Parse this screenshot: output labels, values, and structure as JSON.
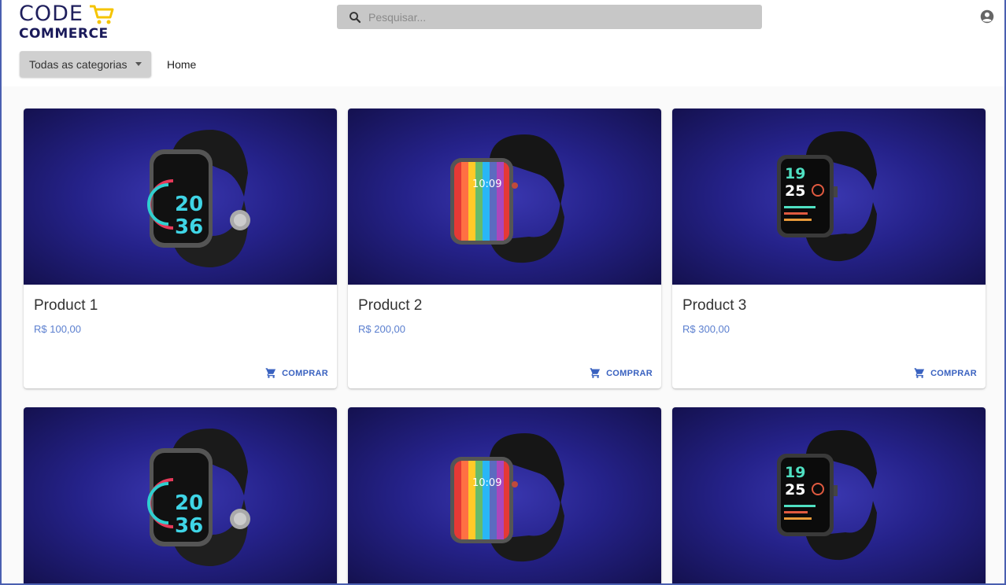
{
  "header": {
    "logo_line1": "CODE",
    "logo_line2": "COMMERCE",
    "search_placeholder": "Pesquisar...",
    "category_select": "Todas as categorias",
    "nav_home": "Home"
  },
  "colors": {
    "brand_dark": "#1a1a5a",
    "brand_yellow": "#f5c400",
    "accent_blue": "#3a62c0",
    "price_blue": "#5b7fcf",
    "image_background": "#25228a"
  },
  "products": [
    {
      "title": "Product 1",
      "price": "R$ 100,00",
      "action": "COMPRAR",
      "watch_style": "round-dial",
      "watch_texts": [
        "20",
        "36"
      ]
    },
    {
      "title": "Product 2",
      "price": "R$ 200,00",
      "action": "COMPRAR",
      "watch_style": "rainbow",
      "watch_texts": [
        "10:09"
      ]
    },
    {
      "title": "Product 3",
      "price": "R$ 300,00",
      "action": "COMPRAR",
      "watch_style": "black-fitness",
      "watch_texts": [
        "19",
        "25"
      ]
    },
    {
      "title": "",
      "price": "",
      "action": "",
      "watch_style": "round-dial",
      "watch_texts": [
        "20",
        "36"
      ]
    },
    {
      "title": "",
      "price": "",
      "action": "",
      "watch_style": "rainbow",
      "watch_texts": [
        "10:09"
      ]
    },
    {
      "title": "",
      "price": "",
      "action": "",
      "watch_style": "black-fitness",
      "watch_texts": [
        "19",
        "25"
      ]
    }
  ],
  "icons": {
    "search": "search-icon",
    "account": "account-circle-icon",
    "cart": "shopping-cart-icon",
    "dropdown": "chevron-down-icon",
    "logo_cart": "logo-cart-icon"
  }
}
